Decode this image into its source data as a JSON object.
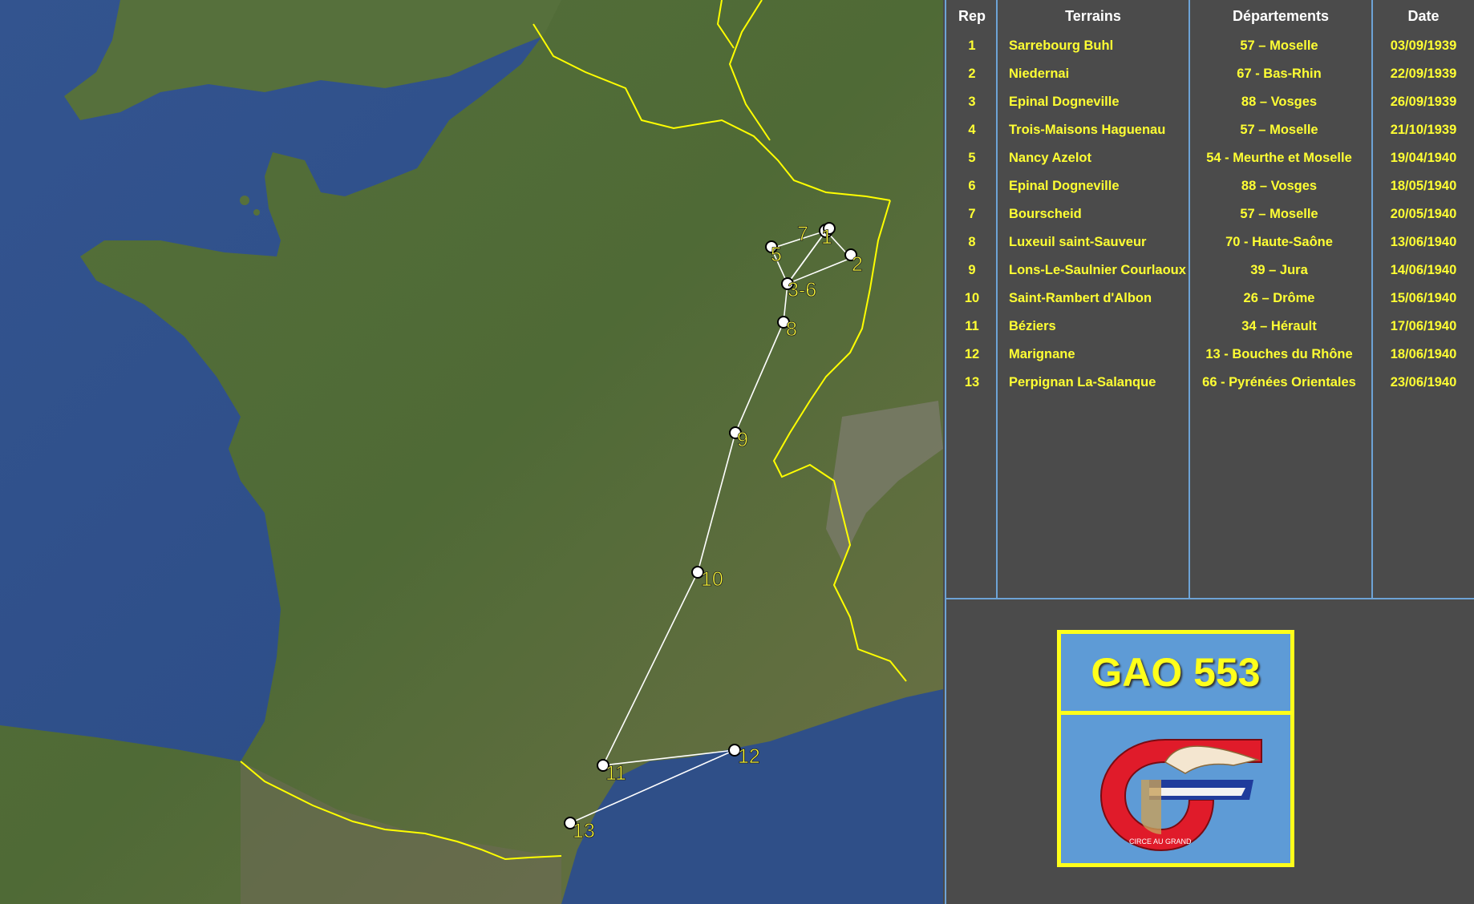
{
  "map": {
    "route_color": "#ffffff",
    "border_color": "#ffff00",
    "label_color": "#ffff33",
    "markers": [
      {
        "label": "1"
      },
      {
        "label": "2"
      },
      {
        "label": "5"
      },
      {
        "label": "7"
      },
      {
        "label": "3-6"
      },
      {
        "label": "8"
      },
      {
        "label": "9"
      },
      {
        "label": "10"
      },
      {
        "label": "11"
      },
      {
        "label": "12"
      },
      {
        "label": "13"
      }
    ]
  },
  "table": {
    "headers": {
      "rep": "Rep",
      "terrains": "Terrains",
      "departements": "Départements",
      "date": "Date"
    },
    "rows": [
      {
        "rep": "1",
        "terrain": "Sarrebourg Buhl",
        "departement": "57 – Moselle",
        "date": "03/09/1939"
      },
      {
        "rep": "2",
        "terrain": "Niedernai",
        "departement": "67 - Bas-Rhin",
        "date": "22/09/1939"
      },
      {
        "rep": "3",
        "terrain": "Epinal Dogneville",
        "departement": "88 – Vosges",
        "date": "26/09/1939"
      },
      {
        "rep": "4",
        "terrain": "Trois-Maisons Haguenau",
        "departement": "57 – Moselle",
        "date": "21/10/1939"
      },
      {
        "rep": "5",
        "terrain": "Nancy Azelot",
        "departement": "54 - Meurthe et Moselle",
        "date": "19/04/1940"
      },
      {
        "rep": "6",
        "terrain": "Epinal Dogneville",
        "departement": "88 – Vosges",
        "date": "18/05/1940"
      },
      {
        "rep": "7",
        "terrain": "Bourscheid",
        "departement": "57 – Moselle",
        "date": "20/05/1940"
      },
      {
        "rep": "8",
        "terrain": "Luxeuil saint-Sauveur",
        "departement": "70 - Haute-Saône",
        "date": "13/06/1940"
      },
      {
        "rep": "9",
        "terrain": "Lons-Le-Saulnier Courlaoux",
        "departement": "39 – Jura",
        "date": "14/06/1940"
      },
      {
        "rep": "10",
        "terrain": "Saint-Rambert d'Albon",
        "departement": "26 – Drôme",
        "date": "15/06/1940"
      },
      {
        "rep": "11",
        "terrain": "Béziers",
        "departement": "34 – Hérault",
        "date": "17/06/1940"
      },
      {
        "rep": "12",
        "terrain": "Marignane",
        "departement": "13 - Bouches du Rhône",
        "date": "18/06/1940"
      },
      {
        "rep": "13",
        "terrain": "Perpignan La-Salanque",
        "departement": "66 - Pyrénées Orientales",
        "date": "23/06/1940"
      }
    ]
  },
  "badge": {
    "title": "GAO 553",
    "title_color": "#ffff1a",
    "background_color": "#5e9bd6",
    "insignia_text": "CIRCE AU GRAND"
  }
}
